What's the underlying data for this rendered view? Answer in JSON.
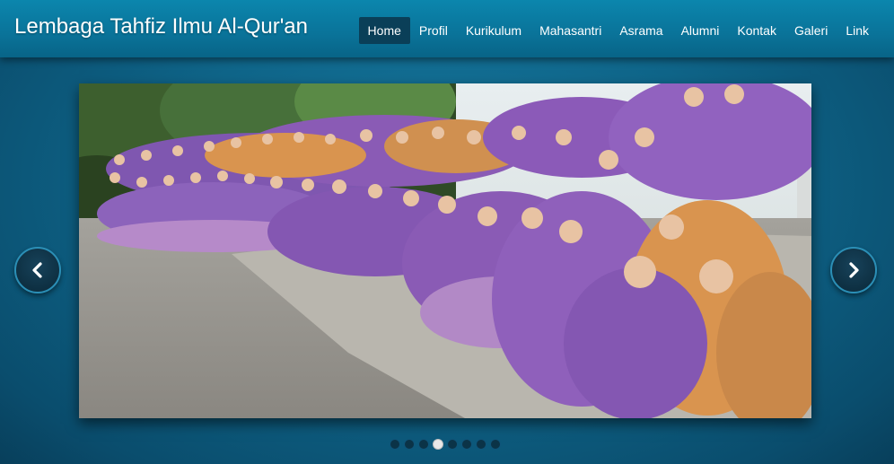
{
  "site": {
    "title": "Lembaga Tahfiz Ilmu Al-Qur'an"
  },
  "nav": {
    "items": [
      {
        "label": "Home",
        "active": true
      },
      {
        "label": "Profil"
      },
      {
        "label": "Kurikulum"
      },
      {
        "label": "Mahasantri"
      },
      {
        "label": "Asrama"
      },
      {
        "label": "Alumni"
      },
      {
        "label": "Kontak"
      },
      {
        "label": "Galeri"
      },
      {
        "label": "Link"
      }
    ]
  },
  "slider": {
    "image_description": "group-photo",
    "prev_icon": "chevron-left-icon",
    "next_icon": "chevron-right-icon",
    "slide_count": 8,
    "active_slide": 4
  },
  "colors": {
    "header": "#0a7399",
    "background": "#0f6589",
    "nav_active": "#0a3f58",
    "hijab_purple": "#8a5bb5",
    "hijab_orange": "#d9944f"
  }
}
